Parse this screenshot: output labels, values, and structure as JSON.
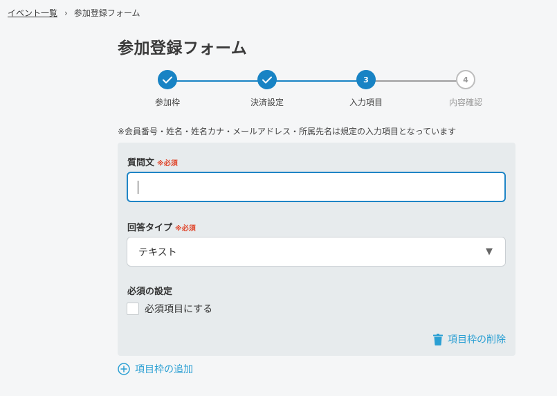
{
  "breadcrumb": {
    "parent_label": "イベント一覧",
    "separator": "›",
    "current_label": "参加登録フォーム"
  },
  "page": {
    "title": "参加登録フォーム"
  },
  "stepper": {
    "steps": [
      {
        "number": "1",
        "label": "参加枠",
        "state": "done"
      },
      {
        "number": "2",
        "label": "決済設定",
        "state": "done"
      },
      {
        "number": "3",
        "label": "入力項目",
        "state": "current"
      },
      {
        "number": "4",
        "label": "内容確認",
        "state": "todo"
      }
    ]
  },
  "note": "※会員番号・姓名・姓名カナ・メールアドレス・所属先名は規定の入力項目となっています",
  "form": {
    "question": {
      "label": "質問文",
      "required_mark": "※必須",
      "value": ""
    },
    "answer_type": {
      "label": "回答タイプ",
      "required_mark": "※必須",
      "selected": "テキスト"
    },
    "required_setting": {
      "label": "必須の設定",
      "checkbox_label": "必須項目にする",
      "checked": false
    },
    "delete_label": "項目枠の削除"
  },
  "add_label": "項目枠の追加",
  "colors": {
    "accent": "#1883c4",
    "link": "#2a9fd3",
    "required": "#e0462b",
    "panel_bg": "#e7ebed",
    "page_bg": "#f5f6f7"
  }
}
